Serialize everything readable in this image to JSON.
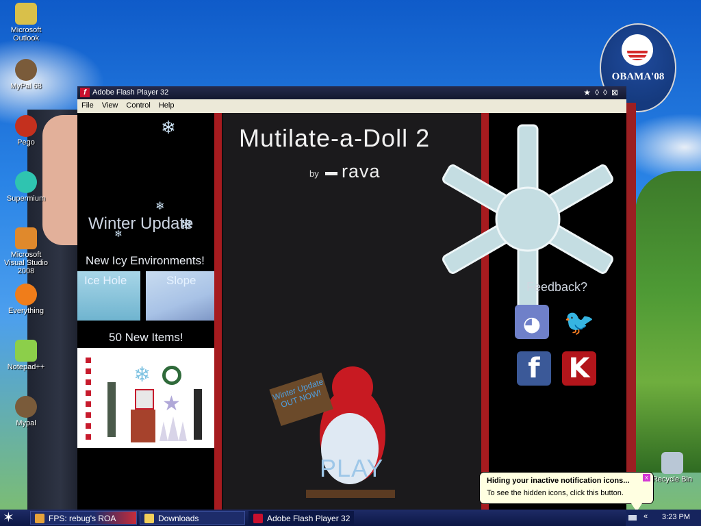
{
  "desktop": {
    "icons": [
      {
        "label": "Microsoft Outlook",
        "icon": "outlook-icon"
      },
      {
        "label": "MyPal 68",
        "icon": "mypal-icon"
      },
      {
        "label": "Pego",
        "icon": "pego-icon"
      },
      {
        "label": "Supermium",
        "icon": "supermium-icon"
      },
      {
        "label": "Microsoft Visual Studio 2008",
        "icon": "visual-studio-icon"
      },
      {
        "label": "Everything",
        "icon": "everything-icon"
      },
      {
        "label": "Notepad++",
        "icon": "notepadpp-icon"
      },
      {
        "label": "Mypal",
        "icon": "mypal-icon"
      }
    ],
    "recycle_bin_label": "Recycle Bin",
    "badge_text": "OBAMA'08"
  },
  "window": {
    "title": "Adobe Flash Player 32",
    "menu": [
      "File",
      "View",
      "Control",
      "Help"
    ]
  },
  "game": {
    "title": "Mutilate-a-Doll 2",
    "by": "by",
    "author": "rava",
    "left": {
      "heading": "Winter Update",
      "subheading": "New Icy Environments!",
      "environments": [
        "Ice Hole",
        "Slope"
      ],
      "items_heading": "50 New Items!"
    },
    "sign_text": "Winter Update OUT NOW!",
    "play_label": "PLAY",
    "feedback_label": "Feedback?",
    "social": [
      {
        "name": "discord",
        "icon": "discord-icon",
        "color": "#6f80c9"
      },
      {
        "name": "twitter",
        "icon": "twitter-icon",
        "color": "#1da1f2"
      },
      {
        "name": "facebook",
        "icon": "facebook-icon",
        "color": "#3b5998"
      },
      {
        "name": "kongregate",
        "icon": "kongregate-icon",
        "color": "#b3151b"
      }
    ]
  },
  "notification": {
    "title": "Hiding your inactive notification icons...",
    "body": "To see the hidden icons, click this button."
  },
  "taskbar": {
    "tasks": [
      {
        "label": "FPS: rebug's ROA",
        "icon": "browser-icon"
      },
      {
        "label": "Downloads",
        "icon": "folder-icon"
      },
      {
        "label": "Adobe Flash Player 32",
        "icon": "flash-icon"
      }
    ],
    "clock": "3:23 PM"
  }
}
